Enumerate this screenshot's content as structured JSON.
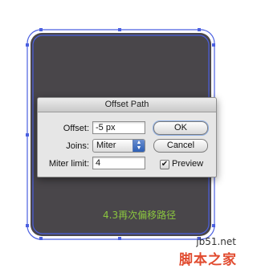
{
  "dialog": {
    "title": "Offset Path",
    "offset": {
      "label": "Offset:",
      "value": "-5 px"
    },
    "joins": {
      "label": "Joins:",
      "selected": "Miter"
    },
    "miter_limit": {
      "label": "Miter limit:",
      "value": "4"
    },
    "ok_label": "OK",
    "cancel_label": "Cancel",
    "preview": {
      "label": "Preview",
      "checked": true
    }
  },
  "canvas": {
    "caption": "4.3再次偏移路径",
    "shape_fill": "#49464a",
    "path_color": "#4a5fe0",
    "caption_color": "#8bc63f"
  },
  "watermark": {
    "site": "jb51.net",
    "brand": "脚本之家"
  },
  "icons": {
    "checkmark": "checkmark-icon",
    "select_arrows": "updown-arrows-icon"
  }
}
